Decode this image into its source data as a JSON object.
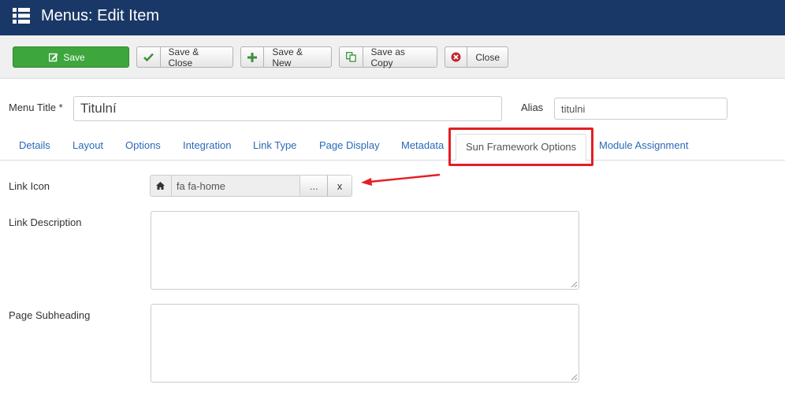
{
  "header": {
    "title": "Menus: Edit Item",
    "icon": "list-icon"
  },
  "toolbar": {
    "save": "Save",
    "save_close": "Save & Close",
    "save_new": "Save & New",
    "save_copy": "Save as Copy",
    "close": "Close"
  },
  "form": {
    "menu_title_label": "Menu Title *",
    "menu_title_value": "Titulní",
    "alias_label": "Alias",
    "alias_value": "titulni"
  },
  "tabs": [
    {
      "label": "Details"
    },
    {
      "label": "Layout"
    },
    {
      "label": "Options"
    },
    {
      "label": "Integration"
    },
    {
      "label": "Link Type"
    },
    {
      "label": "Page Display"
    },
    {
      "label": "Metadata"
    },
    {
      "label": "Sun Framework Options",
      "active": true
    },
    {
      "label": "Module Assignment"
    }
  ],
  "fields": {
    "link_icon_label": "Link Icon",
    "link_icon_value": "fa fa-home",
    "select_button": "...",
    "clear_button": "x",
    "link_description_label": "Link Description",
    "page_subheading_label": "Page Subheading"
  },
  "colors": {
    "header_bg": "#1a3867",
    "save_green": "#3da63d",
    "link_blue": "#2a69b8",
    "highlight_red": "#e31e24"
  }
}
